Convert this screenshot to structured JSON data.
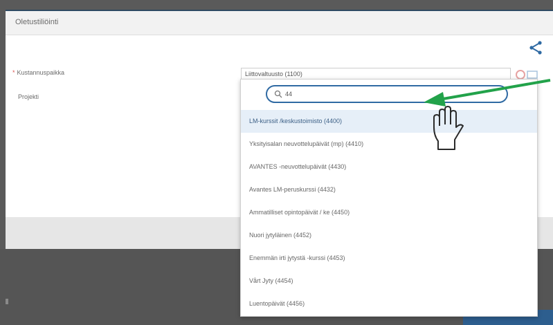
{
  "dialog": {
    "title": "Oletustiliöinti"
  },
  "form": {
    "cost_center_label": "Kustannuspaikka",
    "cost_center_value": "Liittovaltuusto (1100)",
    "project_label": "Projekti"
  },
  "dropdown": {
    "search_value": "44",
    "options": [
      "LM-kurssit /keskustoimisto (4400)",
      "Yksityisalan neuvottelupäivät (mp) (4410)",
      "AVANTES -neuvottelupäivät (4430)",
      "Avantes LM-peruskurssi (4432)",
      "Ammatilliset opintopäivät / ke (4450)",
      "Nuori jytyläinen (4452)",
      "Enemmän irti jytystä -kurssi (4453)",
      "Vårt Jyty (4454)",
      "Luentopäivät (4456)"
    ]
  },
  "colors": {
    "accent": "#2f6aa3",
    "arrow": "#22a24a",
    "required": "#d9534f"
  }
}
